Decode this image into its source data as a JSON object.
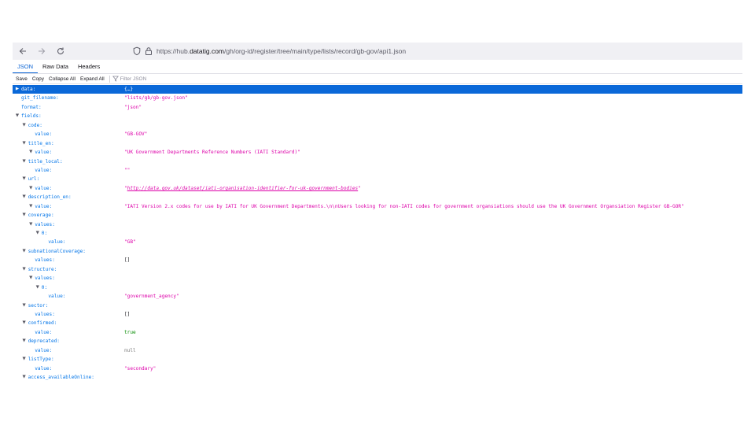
{
  "browser": {
    "url_prefix": "https://hub.",
    "url_domain": "datatig.com",
    "url_path": "/gh/org-id/register/tree/main/type/lists/record/gb-gov/api1.json"
  },
  "tabs": [
    "JSON",
    "Raw Data",
    "Headers"
  ],
  "toolbar": {
    "save": "Save",
    "copy": "Copy",
    "collapse_all": "Collapse All",
    "expand_all": "Expand All",
    "filter_placeholder": "Filter JSON"
  },
  "tree": [
    {
      "depth": 0,
      "toggle": "collapsed",
      "key": "data:",
      "value": "{…}",
      "vtype": "obj",
      "selected": true
    },
    {
      "depth": 0,
      "toggle": "",
      "key": "git_filename:",
      "value": "\"lists/gb/gb-gov.json\"",
      "vtype": "str"
    },
    {
      "depth": 0,
      "toggle": "",
      "key": "format:",
      "value": "\"json\"",
      "vtype": "str"
    },
    {
      "depth": 0,
      "toggle": "expanded",
      "key": "fields:",
      "value": "",
      "vtype": ""
    },
    {
      "depth": 1,
      "toggle": "expanded",
      "key": "code:",
      "value": "",
      "vtype": ""
    },
    {
      "depth": 2,
      "toggle": "",
      "key": "value:",
      "value": "\"GB-GOV\"",
      "vtype": "str"
    },
    {
      "depth": 1,
      "toggle": "expanded",
      "key": "title_en:",
      "value": "",
      "vtype": ""
    },
    {
      "depth": 2,
      "toggle": "expanded",
      "key": "value:",
      "value": "\"UK Government Departments Reference Numbers (IATI Standard)\"",
      "vtype": "str"
    },
    {
      "depth": 1,
      "toggle": "expanded",
      "key": "title_local:",
      "value": "",
      "vtype": ""
    },
    {
      "depth": 2,
      "toggle": "",
      "key": "value:",
      "value": "\"\"",
      "vtype": "str"
    },
    {
      "depth": 1,
      "toggle": "expanded",
      "key": "url:",
      "value": "",
      "vtype": ""
    },
    {
      "depth": 2,
      "toggle": "expanded",
      "key": "value:",
      "value": "http://data.gov.uk/dataset/iati-organisation-identifier-for-uk-government-bodies",
      "vtype": "link"
    },
    {
      "depth": 1,
      "toggle": "expanded",
      "key": "description_en:",
      "value": "",
      "vtype": ""
    },
    {
      "depth": 2,
      "toggle": "expanded",
      "key": "value:",
      "value": "\"IATI Version 2.x codes for use by IATI for UK Government Departments.\\n\\nUsers looking for non-IATI codes for government organsiations should use the UK Government Organsiation Register GB-GOR\"",
      "vtype": "str"
    },
    {
      "depth": 1,
      "toggle": "expanded",
      "key": "coverage:",
      "value": "",
      "vtype": ""
    },
    {
      "depth": 2,
      "toggle": "expanded",
      "key": "values:",
      "value": "",
      "vtype": ""
    },
    {
      "depth": 3,
      "toggle": "expanded",
      "key": "0:",
      "value": "",
      "vtype": ""
    },
    {
      "depth": 4,
      "toggle": "",
      "key": "value:",
      "value": "\"GB\"",
      "vtype": "str"
    },
    {
      "depth": 1,
      "toggle": "expanded",
      "key": "subnationalCoverage:",
      "value": "",
      "vtype": ""
    },
    {
      "depth": 2,
      "toggle": "",
      "key": "values:",
      "value": "[]",
      "vtype": "empty"
    },
    {
      "depth": 1,
      "toggle": "expanded",
      "key": "structure:",
      "value": "",
      "vtype": ""
    },
    {
      "depth": 2,
      "toggle": "expanded",
      "key": "values:",
      "value": "",
      "vtype": ""
    },
    {
      "depth": 3,
      "toggle": "expanded",
      "key": "0:",
      "value": "",
      "vtype": ""
    },
    {
      "depth": 4,
      "toggle": "",
      "key": "value:",
      "value": "\"government_agency\"",
      "vtype": "str"
    },
    {
      "depth": 1,
      "toggle": "expanded",
      "key": "sector:",
      "value": "",
      "vtype": ""
    },
    {
      "depth": 2,
      "toggle": "",
      "key": "values:",
      "value": "[]",
      "vtype": "empty"
    },
    {
      "depth": 1,
      "toggle": "expanded",
      "key": "confirmed:",
      "value": "",
      "vtype": ""
    },
    {
      "depth": 2,
      "toggle": "",
      "key": "value:",
      "value": "true",
      "vtype": "bool"
    },
    {
      "depth": 1,
      "toggle": "expanded",
      "key": "deprecated:",
      "value": "",
      "vtype": ""
    },
    {
      "depth": 2,
      "toggle": "",
      "key": "value:",
      "value": "null",
      "vtype": "null"
    },
    {
      "depth": 1,
      "toggle": "expanded",
      "key": "listType:",
      "value": "",
      "vtype": ""
    },
    {
      "depth": 2,
      "toggle": "",
      "key": "value:",
      "value": "\"secondary\"",
      "vtype": "str"
    },
    {
      "depth": 1,
      "toggle": "expanded",
      "key": "access_availableOnline:",
      "value": "",
      "vtype": ""
    }
  ]
}
